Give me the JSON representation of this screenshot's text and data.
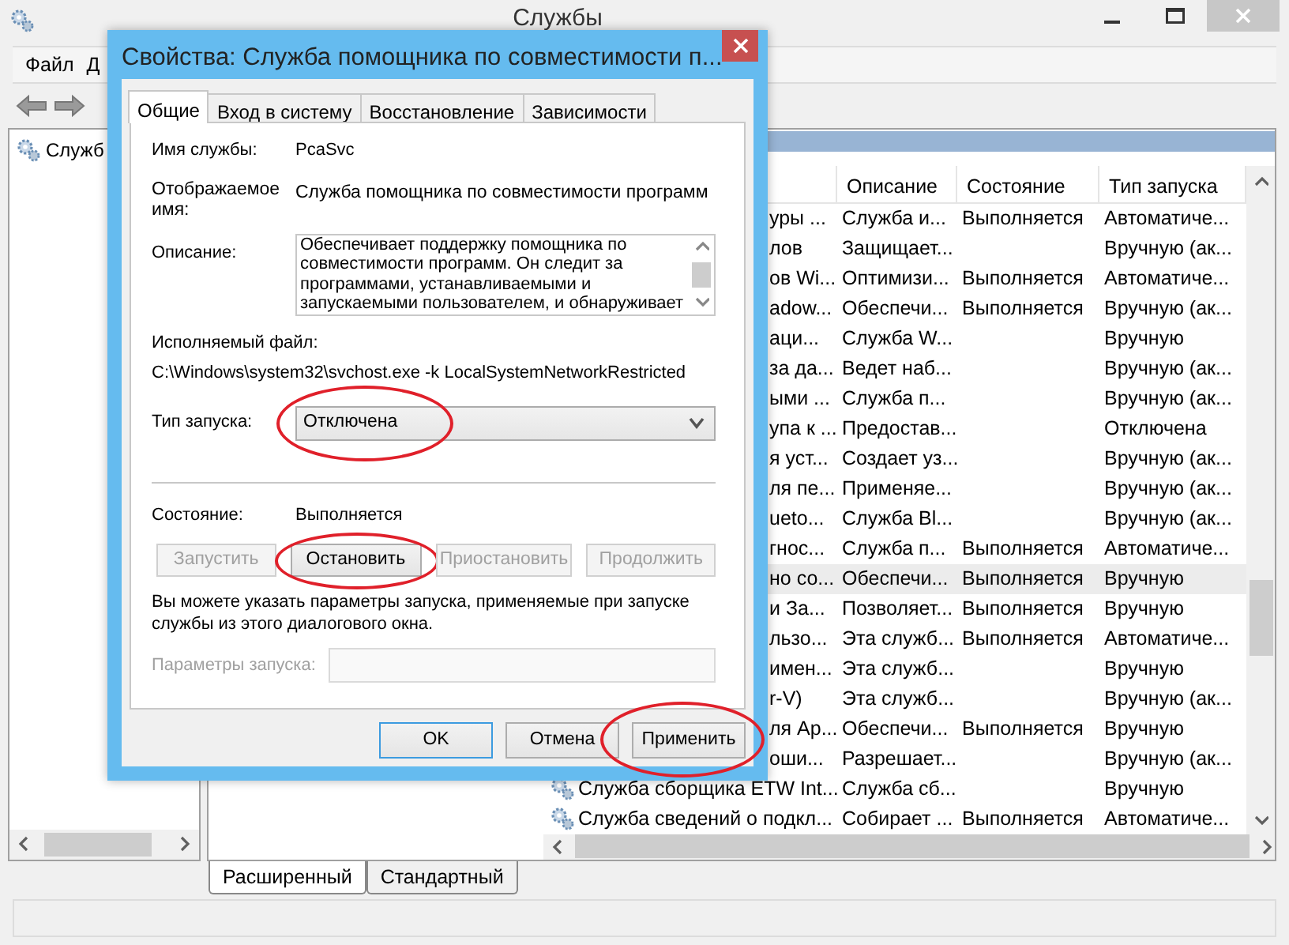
{
  "window": {
    "title": "Службы"
  },
  "menu": [
    {
      "label": "Файл"
    },
    {
      "label": "Д"
    }
  ],
  "tree": {
    "items": [
      {
        "label": "Служб"
      }
    ]
  },
  "list": {
    "columns": [
      "Описание",
      "Состояние",
      "Тип запуска"
    ],
    "rows": [
      {
        "kind": "cut",
        "name": "уры ...",
        "description": "Служба и...",
        "status": "Выполняется",
        "startup": "Автоматиче...",
        "selected": false
      },
      {
        "kind": "cut",
        "name": "лов",
        "description": "Защищает...",
        "startup": "Вручную (ак...",
        "selected": false
      },
      {
        "kind": "cut",
        "name": "ов Wi...",
        "description": "Оптимизи...",
        "status": "Выполняется",
        "startup": "Автоматиче...",
        "selected": false
      },
      {
        "kind": "cut",
        "name": "adow...",
        "description": "Обеспечи...",
        "status": "Выполняется",
        "startup": "Вручную (ак...",
        "selected": false
      },
      {
        "kind": "cut",
        "name": "аци...",
        "description": "Служба W...",
        "startup": "Вручную",
        "selected": false
      },
      {
        "kind": "cut",
        "name": "за да...",
        "description": "Ведет наб...",
        "startup": "Вручную (ак...",
        "selected": false
      },
      {
        "kind": "cut",
        "name": "ыми ...",
        "description": "Служба п...",
        "startup": "Вручную (ак...",
        "selected": false
      },
      {
        "kind": "cut",
        "name": "упа к ...",
        "description": "Предостав...",
        "startup": "Отключена",
        "selected": false
      },
      {
        "kind": "cut",
        "name": "я уст...",
        "description": "Создает уз...",
        "startup": "Вручную (ак...",
        "selected": false
      },
      {
        "kind": "cut",
        "name": "ля пе...",
        "description": "Применяе...",
        "startup": "Вручную (ак...",
        "selected": false
      },
      {
        "kind": "cut",
        "name": "ueto...",
        "description": "Служба Bl...",
        "startup": "Вручную (ак...",
        "selected": false
      },
      {
        "kind": "cut",
        "name": "гнос...",
        "description": "Служба п...",
        "status": "Выполняется",
        "startup": "Автоматиче...",
        "selected": false
      },
      {
        "kind": "cut",
        "name": "но со...",
        "description": "Обеспечи...",
        "status": "Выполняется",
        "startup": "Вручную",
        "selected": true
      },
      {
        "kind": "cut",
        "name": "и За...",
        "description": "Позволяет...",
        "status": "Выполняется",
        "startup": "Вручную",
        "selected": false
      },
      {
        "kind": "cut",
        "name": "льзо...",
        "description": "Эта служб...",
        "status": "Выполняется",
        "startup": "Автоматиче...",
        "selected": false
      },
      {
        "kind": "cut",
        "name": "имен...",
        "description": "Эта служб...",
        "startup": "Вручную",
        "selected": false
      },
      {
        "kind": "cut",
        "name": "r-V)",
        "description": "Эта служб...",
        "startup": "Вручную (ак...",
        "selected": false
      },
      {
        "kind": "cut",
        "name": "ля Ар...",
        "description": "Обеспечи...",
        "status": "Выполняется",
        "startup": "Вручную",
        "selected": false
      },
      {
        "kind": "cut",
        "name": "оши...",
        "description": "Разрешает...",
        "startup": "Вручную (ак...",
        "selected": false
      },
      {
        "kind": "full",
        "name": "Служба сборщика ETW Int...",
        "description": "Служба сб...",
        "startup": "Вручную",
        "selected": false
      },
      {
        "kind": "full",
        "name": "Служба сведений о подкл...",
        "description": "Собирает ...",
        "status": "Выполняется",
        "startup": "Автоматиче...",
        "selected": false
      }
    ]
  },
  "view_tabs": [
    {
      "label": "Расширенный",
      "selected": true
    },
    {
      "label": "Стандартный",
      "selected": false
    }
  ],
  "dialog": {
    "title": "Свойства: Служба помощника по совместимости п...",
    "tabs": [
      {
        "label": "Общие",
        "selected": true
      },
      {
        "label": "Вход в систему",
        "selected": false
      },
      {
        "label": "Восстановление",
        "selected": false
      },
      {
        "label": "Зависимости",
        "selected": false
      }
    ],
    "service_name": {
      "label": "Имя службы:",
      "value": "PcaSvc"
    },
    "display_name": {
      "label": "Отображаемое имя:",
      "value": "Служба помощника по совместимости программ"
    },
    "description": {
      "label": "Описание:",
      "value": "Обеспечивает поддержку помощника по совместимости программ. Он следит за программами, устанавливаемыми и запускаемыми пользователем, и обнаруживает"
    },
    "executable": {
      "label": "Исполняемый файл:",
      "value": "C:\\Windows\\system32\\svchost.exe -k LocalSystemNetworkRestricted"
    },
    "startup_type": {
      "label": "Тип запуска:",
      "value": "Отключена",
      "circled": true
    },
    "status": {
      "label": "Состояние:",
      "value": "Выполняется"
    },
    "service_buttons": [
      {
        "label": "Запустить",
        "disabled": true,
        "circled": false
      },
      {
        "label": "Остановить",
        "disabled": false,
        "circled": true
      },
      {
        "label": "Приостановить",
        "disabled": true,
        "circled": false
      },
      {
        "label": "Продолжить",
        "disabled": true,
        "circled": false
      }
    ],
    "hint": "Вы можете указать параметры запуска, применяемые при запуске службы из этого диалогового окна.",
    "parameters": {
      "label": "Параметры запуска:",
      "disabled": true
    },
    "buttons": [
      {
        "label": "OK",
        "default": true,
        "circled": false
      },
      {
        "label": "Отмена",
        "default": false,
        "circled": false
      },
      {
        "label": "Применить",
        "default": false,
        "circled": true
      }
    ]
  }
}
